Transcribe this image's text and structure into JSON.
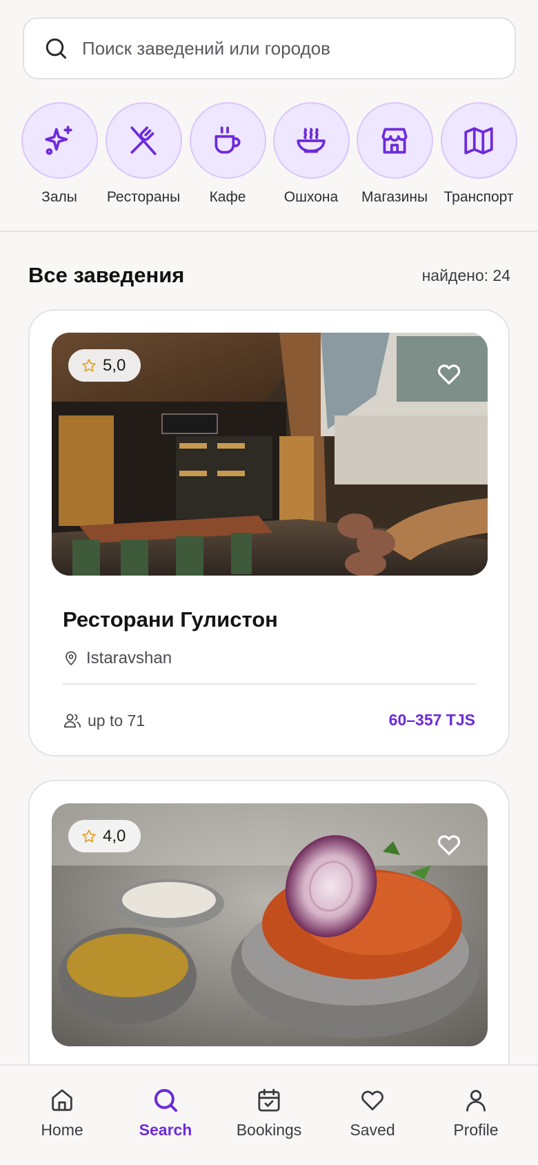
{
  "search": {
    "placeholder": "Поиск заведений или городов"
  },
  "categories": [
    {
      "label": "Залы",
      "icon": "sparkles-icon"
    },
    {
      "label": "Рестораны",
      "icon": "utensils-icon"
    },
    {
      "label": "Кафе",
      "icon": "coffee-cup-icon"
    },
    {
      "label": "Ошхона",
      "icon": "soup-bowl-icon"
    },
    {
      "label": "Магазины",
      "icon": "store-icon"
    },
    {
      "label": "Транспорт",
      "icon": "map-icon"
    }
  ],
  "section": {
    "title": "Все заведения",
    "found": "найдено: 24"
  },
  "venues": [
    {
      "rating": "5,0",
      "name": "Ресторани Гулистон",
      "location": "Istaravshan",
      "capacity": "up to 71",
      "price": "60–357 TJS"
    },
    {
      "rating": "4,0"
    }
  ],
  "nav": [
    {
      "label": "Home",
      "icon": "home-icon"
    },
    {
      "label": "Search",
      "icon": "search-icon"
    },
    {
      "label": "Bookings",
      "icon": "calendar-check-icon"
    },
    {
      "label": "Saved",
      "icon": "heart-icon"
    },
    {
      "label": "Profile",
      "icon": "user-icon"
    }
  ],
  "colors": {
    "accent": "#6c2bd9",
    "category_bg": "#efe6ff",
    "background": "#f8f7f5"
  }
}
